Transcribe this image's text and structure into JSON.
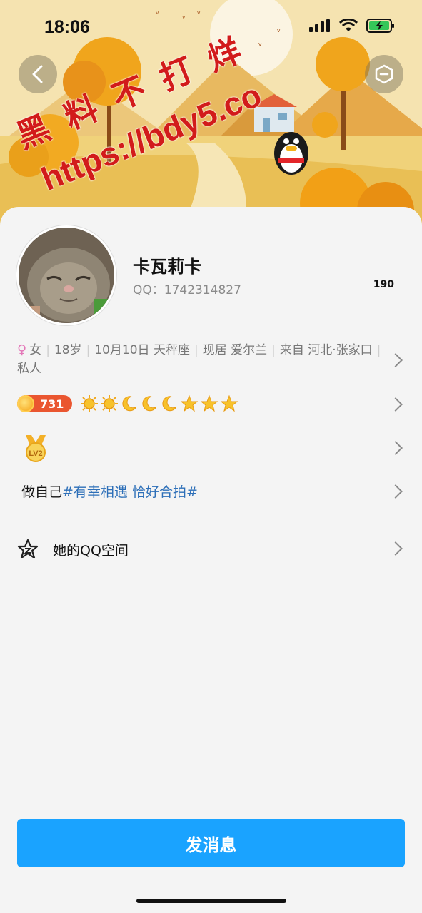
{
  "status_bar": {
    "time": "18:06"
  },
  "watermark": {
    "line1": "黑料不打烊",
    "line2": "https://bdy5.co"
  },
  "profile": {
    "nickname": "卡瓦莉卡",
    "qq_label": "QQ：1742314827",
    "like_count": "190"
  },
  "info": {
    "gender": "女",
    "age": "18岁",
    "birthday": "10月10日 天秤座",
    "residence": "现居 爱尔兰",
    "hometown": "来自 河北·张家口",
    "extra": "私人"
  },
  "level": {
    "coin_value": "731",
    "icons": [
      "sun-icon",
      "sun-icon",
      "moon-icon",
      "moon-icon",
      "moon-icon",
      "star-icon",
      "star-icon",
      "star-icon"
    ]
  },
  "vip": {
    "badge": "LV2"
  },
  "signature": {
    "text": "做自己",
    "tags": "#有幸相遇 恰好合拍#"
  },
  "qzone": {
    "label": "她的QQ空间"
  },
  "actions": {
    "send_message": "发消息"
  },
  "colors": {
    "primary": "#1aa3ff",
    "tag": "#2d6fb8",
    "coin_badge": "#ea5630",
    "watermark": "#d21b1b"
  }
}
